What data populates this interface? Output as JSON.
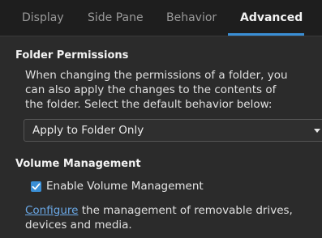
{
  "tabs": [
    {
      "label": "Display",
      "active": false
    },
    {
      "label": "Side Pane",
      "active": false
    },
    {
      "label": "Behavior",
      "active": false
    },
    {
      "label": "Advanced",
      "active": true
    }
  ],
  "folder_permissions": {
    "title": "Folder Permissions",
    "description": "When changing the permissions of a folder, you can also apply the changes to the contents of the folder. Select the default behavior below:",
    "dropdown_value": "Apply to Folder Only"
  },
  "volume_management": {
    "title": "Volume Management",
    "checkbox_label": "Enable Volume Management",
    "checkbox_checked": true,
    "link_text": "Configure",
    "footer_text": " the management of removable drives, devices and media."
  },
  "colors": {
    "accent": "#3a8fd6",
    "link": "#6aa8e6",
    "background": "#2b2b2b",
    "tabbar": "#1e1e1e"
  }
}
